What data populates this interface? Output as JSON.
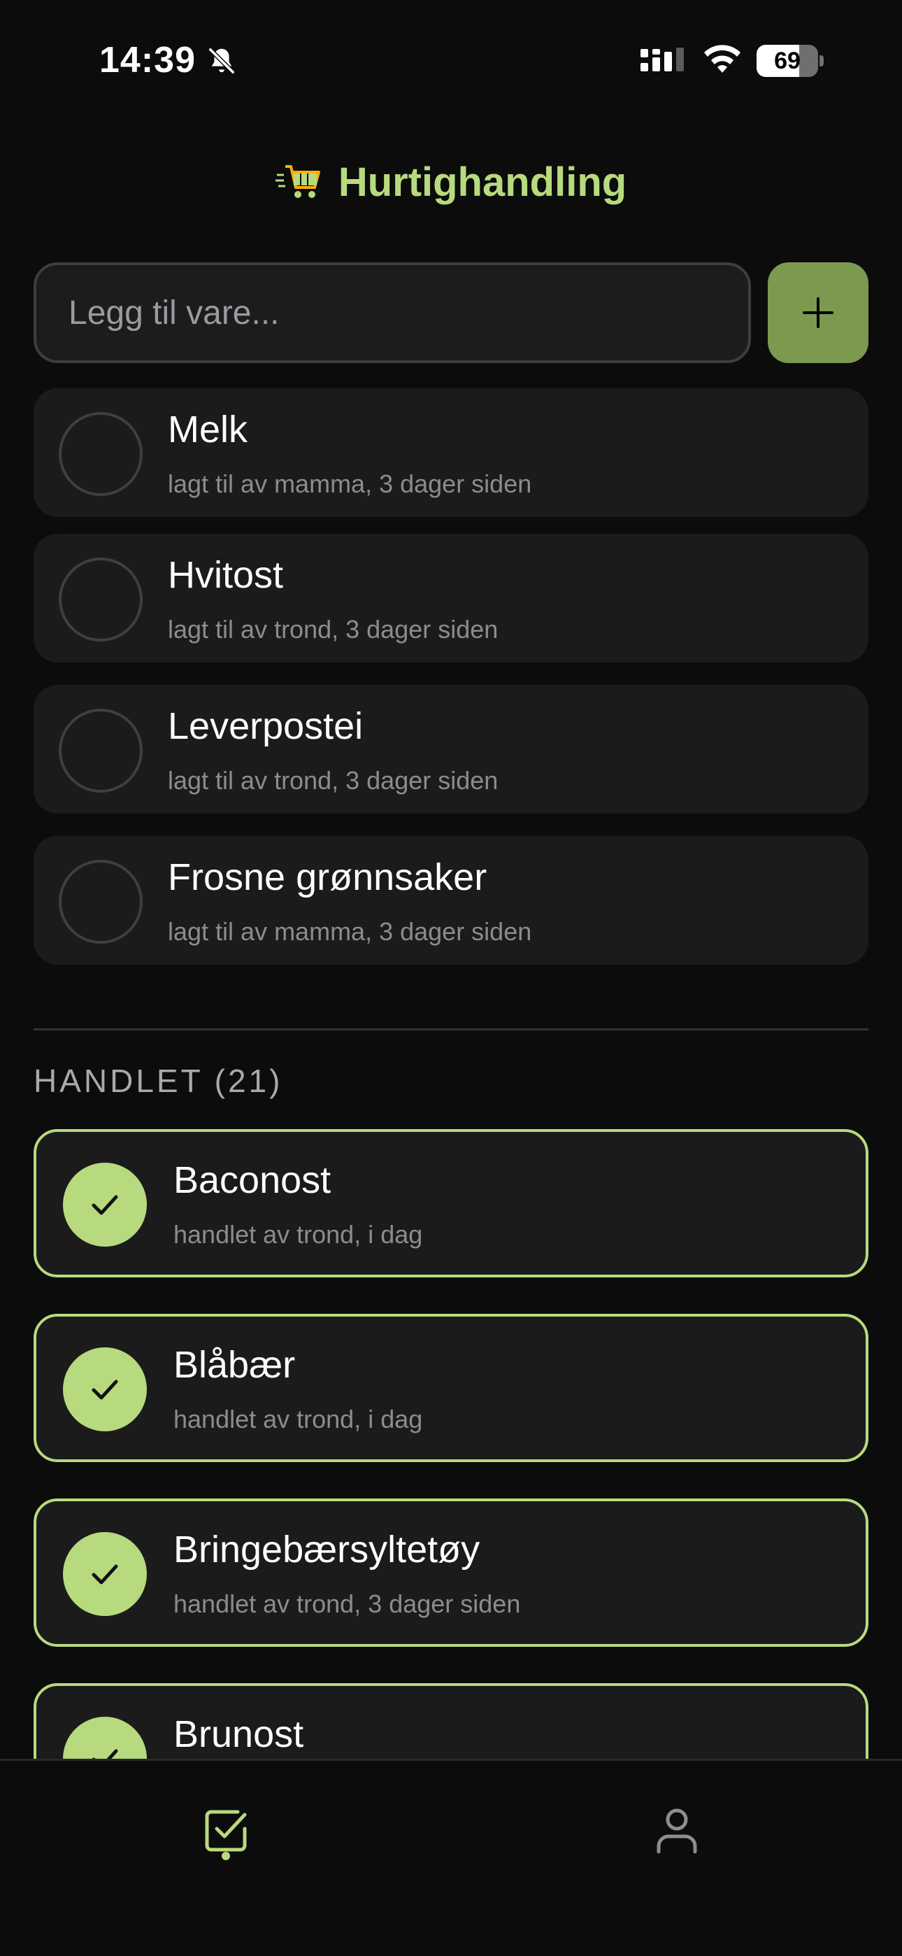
{
  "status_bar": {
    "time": "14:39",
    "battery_level": "69",
    "icons": [
      "bell-slash-icon",
      "signal-icon",
      "wifi-icon",
      "battery-icon"
    ]
  },
  "header": {
    "title": "Hurtighandling",
    "icon": "shopping-cart-icon",
    "accent_color": "#b7da7e"
  },
  "add_item": {
    "placeholder": "Legg til vare...",
    "button_icon": "plus-icon",
    "button_color": "#7c9a4f"
  },
  "pending_items": [
    {
      "name": "Melk",
      "meta": "lagt til av mamma, 3 dager siden"
    },
    {
      "name": "Hvitost",
      "meta": "lagt til av trond, 3 dager siden"
    },
    {
      "name": "Leverpostei",
      "meta": "lagt til av trond, 3 dager siden"
    },
    {
      "name": "Frosne grønnsaker",
      "meta": "lagt til av mamma, 3 dager siden"
    }
  ],
  "bought_section": {
    "label": "HANDLET (21)",
    "items": [
      {
        "name": "Baconost",
        "meta": "handlet av trond, i dag"
      },
      {
        "name": "Blåbær",
        "meta": "handlet av trond, i dag"
      },
      {
        "name": "Bringebærsyltetøy",
        "meta": "handlet av trond, 3 dager siden"
      },
      {
        "name": "Brunost",
        "meta": ""
      }
    ]
  },
  "tab_bar": {
    "tabs": [
      {
        "icon": "checklist-icon",
        "active": true
      },
      {
        "icon": "user-icon",
        "active": false
      }
    ]
  }
}
